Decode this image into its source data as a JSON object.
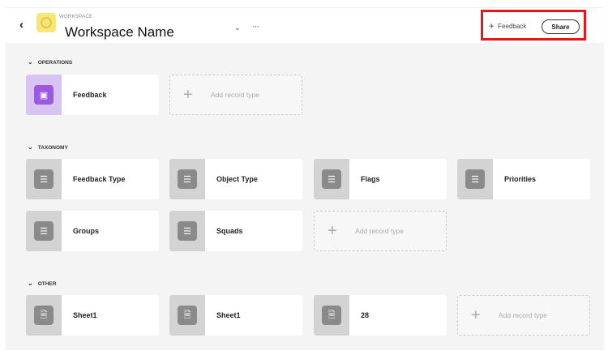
{
  "header": {
    "back": "‹",
    "workspace_label": "WORKSPACE",
    "workspace_name": "Workspace Name",
    "chevron": "⌄",
    "more": "···",
    "feedback": "Feedback",
    "share": "Share"
  },
  "sections": [
    {
      "title": "OPERATIONS",
      "cards": [
        "Feedback"
      ]
    },
    {
      "title": "TAXONOMY",
      "cards": [
        "Feedback Type",
        "Object Type",
        "Flags",
        "Priorities",
        "Groups",
        "Squads"
      ]
    },
    {
      "title": "OTHER",
      "cards": [
        "Sheet1",
        "Sheet1",
        "28"
      ]
    }
  ],
  "add_label": "Add record type",
  "colors": {
    "accent_purple": "#9b59e0",
    "highlight": "#e8141e"
  }
}
